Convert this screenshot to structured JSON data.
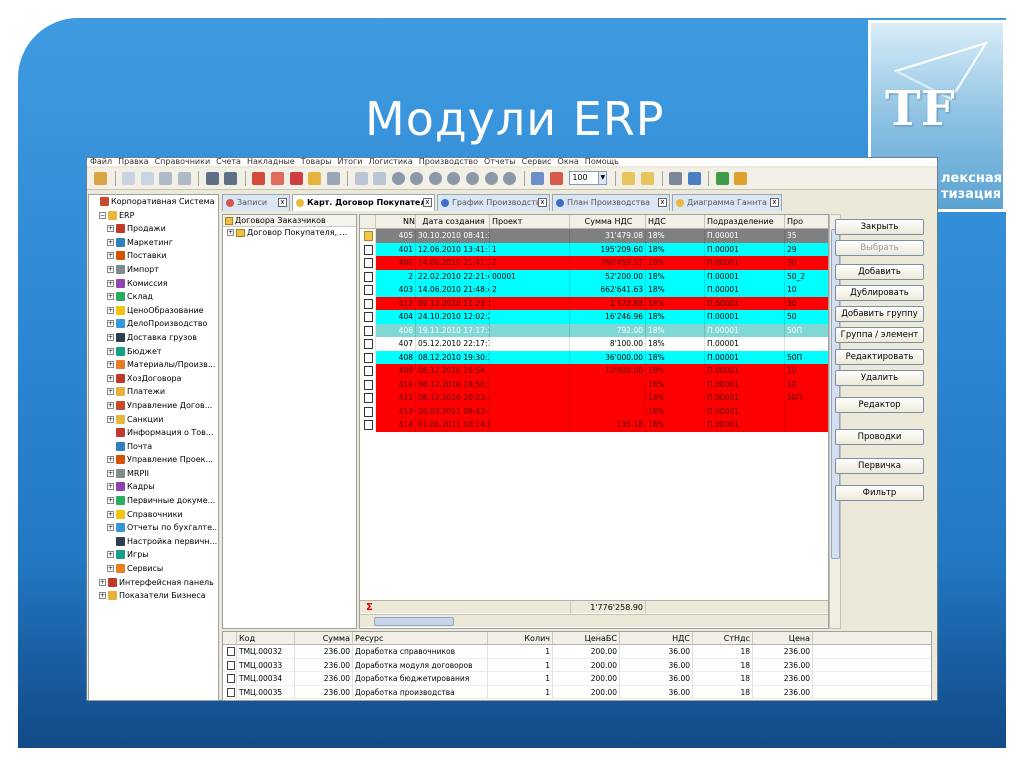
{
  "slide": {
    "title": "Модули ERP"
  },
  "logo": {
    "mark": "TF",
    "text_line1": "лексная",
    "text_line2": "тизация"
  },
  "menu": [
    "Файл",
    "Правка",
    "Справочники",
    "Счета",
    "Накладные",
    "Товары",
    "Итоги",
    "Логистика",
    "Производство",
    "Отчеты",
    "Сервис",
    "Окна",
    "Помощь"
  ],
  "toolbar": {
    "zoom_value": "100",
    "zoom_dropdown": "▼"
  },
  "nav_tree": [
    {
      "label": "Корпоративная Система",
      "level": 0,
      "toggle": ""
    },
    {
      "label": "ERP",
      "level": 1,
      "toggle": "−"
    },
    {
      "label": "Продажи",
      "level": 2,
      "toggle": "+"
    },
    {
      "label": "Маркетинг",
      "level": 2,
      "toggle": "+"
    },
    {
      "label": "Поставки",
      "level": 2,
      "toggle": "+"
    },
    {
      "label": "Импорт",
      "level": 2,
      "toggle": "+"
    },
    {
      "label": "Комиссия",
      "level": 2,
      "toggle": "+"
    },
    {
      "label": "Склад",
      "level": 2,
      "toggle": "+"
    },
    {
      "label": "ЦеноОбразование",
      "level": 2,
      "toggle": "+"
    },
    {
      "label": "ДелоПроизводство",
      "level": 2,
      "toggle": "+"
    },
    {
      "label": "Доставка грузов",
      "level": 2,
      "toggle": "+"
    },
    {
      "label": "Бюджет",
      "level": 2,
      "toggle": "+"
    },
    {
      "label": "Материалы/Произв...",
      "level": 2,
      "toggle": "+"
    },
    {
      "label": "ХозДоговора",
      "level": 2,
      "toggle": "+"
    },
    {
      "label": "Платежи",
      "level": 2,
      "toggle": "+"
    },
    {
      "label": "Управление Догов...",
      "level": 2,
      "toggle": "+"
    },
    {
      "label": "Санкции",
      "level": 2,
      "toggle": "+"
    },
    {
      "label": "Информация о Тов...",
      "level": 2,
      "toggle": ""
    },
    {
      "label": "Почта",
      "level": 2,
      "toggle": ""
    },
    {
      "label": "Управление Проек...",
      "level": 2,
      "toggle": "+"
    },
    {
      "label": "MRPII",
      "level": 2,
      "toggle": "+"
    },
    {
      "label": "Кадры",
      "level": 2,
      "toggle": "+"
    },
    {
      "label": "Первичные докуме...",
      "level": 2,
      "toggle": "+"
    },
    {
      "label": "Справочники",
      "level": 2,
      "toggle": "+"
    },
    {
      "label": "Отчеты по бухгалте...",
      "level": 2,
      "toggle": "+"
    },
    {
      "label": "Настройка первичн...",
      "level": 2,
      "toggle": ""
    },
    {
      "label": "Игры",
      "level": 2,
      "toggle": "+"
    },
    {
      "label": "Сервисы",
      "level": 2,
      "toggle": "+"
    },
    {
      "label": "Интерфейсная панель",
      "level": 1,
      "toggle": "+"
    },
    {
      "label": "Показатели Бизнеса",
      "level": 1,
      "toggle": "+"
    }
  ],
  "tabs": [
    {
      "label": "Записи",
      "close": "x",
      "icon_color": "#d9534f"
    },
    {
      "label": "Карт. Договор Покупателя",
      "close": "x",
      "icon_color": "#e8b93a"
    },
    {
      "label": "График Производства",
      "close": "x",
      "icon_color": "#3a6fc4"
    },
    {
      "label": "План Производства",
      "close": "x",
      "icon_color": "#3a6fc4"
    },
    {
      "label": "Диаграмма Ганнта",
      "close": "x",
      "icon_color": "#e8b93a"
    }
  ],
  "contract_tree": {
    "header": "Договора Заказчиков",
    "items": [
      {
        "label": "Договор Покупателя, ...",
        "toggle": "+"
      }
    ]
  },
  "grid": {
    "columns": [
      "",
      "NN",
      "Дата создания",
      "Проект",
      "Сумма НДС",
      "НДС",
      "Подразделение",
      "Про"
    ],
    "rows": [
      {
        "nn": "405",
        "date": "30.10.2010 08:41:39",
        "project": "",
        "sum": "31'479.08",
        "vat": "18%",
        "dept": "П.00001",
        "pro": "35",
        "bg": "#808080",
        "fg": "#ffffff",
        "icon": "folder"
      },
      {
        "nn": "401",
        "date": "12.06.2010 13:41:14",
        "project": "1",
        "sum": "195'209.60",
        "vat": "18%",
        "dept": "П.00001",
        "pro": "29",
        "bg": "#00ffff",
        "fg": "#000000",
        "icon": "doc"
      },
      {
        "nn": "402",
        "date": "14.06.2010 21:41:24",
        "project": "2",
        "sum": "760'459.57",
        "vat": "18%",
        "dept": "П.00001",
        "pro": "30",
        "bg": "#ff0000",
        "fg": "#5a0000",
        "icon": "doc"
      },
      {
        "nn": "2",
        "date": "22.02.2010 22:21:46",
        "project": "00001",
        "sum": "52'200.00",
        "vat": "18%",
        "dept": "П.00001",
        "pro": "50_2",
        "bg": "#00ffff",
        "fg": "#000000",
        "icon": "doc"
      },
      {
        "nn": "403",
        "date": "14.06.2010 21:48:47",
        "project": "2",
        "sum": "662'641.63",
        "vat": "18%",
        "dept": "П.00001",
        "pro": "10",
        "bg": "#00ffff",
        "fg": "#000000",
        "icon": "doc"
      },
      {
        "nn": "412",
        "date": "09.12.2010 11:23:19",
        "project": "",
        "sum": "1'372.88",
        "vat": "18%",
        "dept": "П.00001",
        "pro": "30",
        "bg": "#ff0000",
        "fg": "#5a0000",
        "icon": "doc"
      },
      {
        "nn": "404",
        "date": "24.10.2010 12:02:23",
        "project": "",
        "sum": "16'246.96",
        "vat": "18%",
        "dept": "П.00001",
        "pro": "50",
        "bg": "#00ffff",
        "fg": "#000000",
        "icon": "doc"
      },
      {
        "nn": "406",
        "date": "19.11.2010 17:17:35",
        "project": "",
        "sum": "792.00",
        "vat": "18%",
        "dept": "П.00001",
        "pro": "50П",
        "bg": "#7fd8d4",
        "fg": "#ffffff",
        "icon": "doc"
      },
      {
        "nn": "407",
        "date": "05.12.2010 22:17:12",
        "project": "",
        "sum": "8'100.00",
        "vat": "18%",
        "dept": "П.00001",
        "pro": "",
        "bg": "#ffffff",
        "fg": "#000000",
        "icon": "doc"
      },
      {
        "nn": "408",
        "date": "08.12.2010 19:30:33",
        "project": "",
        "sum": "36'000.00",
        "vat": "18%",
        "dept": "П.00001",
        "pro": "50П",
        "bg": "#00ffff",
        "fg": "#000000",
        "icon": "doc"
      },
      {
        "nn": "409",
        "date": "08.12.2010 19:54",
        "project": "",
        "sum": "10'800.00",
        "vat": "18%",
        "dept": "П.00001",
        "pro": "10",
        "bg": "#ff0000",
        "fg": "#5a0000",
        "icon": "doc"
      },
      {
        "nn": "410",
        "date": "08.12.2010 19:56:29",
        "project": "",
        "sum": "",
        "vat": "18%",
        "dept": "П.00001",
        "pro": "10",
        "bg": "#ff0000",
        "fg": "#5a0000",
        "icon": "doc"
      },
      {
        "nn": "411",
        "date": "08.12.2010 20:23:48",
        "project": "",
        "sum": "",
        "vat": "18%",
        "dept": "П.00001",
        "pro": "50П",
        "bg": "#ff0000",
        "fg": "#5a0000",
        "icon": "doc"
      },
      {
        "nn": "413",
        "date": "26.03.2011 09:43:37",
        "project": "",
        "sum": "",
        "vat": "18%",
        "dept": "П.00001",
        "pro": "",
        "bg": "#ff0000",
        "fg": "#5a0000",
        "icon": "doc"
      },
      {
        "nn": "414",
        "date": "01.06.2011 18:14:02",
        "project": "",
        "sum": "135.18",
        "vat": "18%",
        "dept": "П.00001",
        "pro": "",
        "bg": "#ff0000",
        "fg": "#5a0000",
        "icon": "doc"
      }
    ],
    "total_sum": "1'776'258.90",
    "sigma": "Σ"
  },
  "buttons": [
    {
      "label": "Закрыть",
      "enabled": true
    },
    {
      "label": "Выбрать",
      "enabled": false
    },
    {
      "label": "Добавить",
      "enabled": true
    },
    {
      "label": "Дублировать",
      "enabled": true
    },
    {
      "label": "Добавить группу",
      "enabled": true
    },
    {
      "label": "Группа / элемент",
      "enabled": true
    },
    {
      "label": "Редактировать",
      "enabled": true
    },
    {
      "label": "Удалить",
      "enabled": true
    },
    {
      "label": "Редактор",
      "enabled": true
    },
    {
      "label": "Проводки",
      "enabled": true
    },
    {
      "label": "Первичка",
      "enabled": true
    },
    {
      "label": "Фильтр",
      "enabled": true
    }
  ],
  "detail": {
    "columns": [
      "",
      "Код",
      "Сумма",
      "Ресурс",
      "Колич",
      "ЦенаБС",
      "НДС",
      "СтНдс",
      "Цена"
    ],
    "rows": [
      {
        "code": "ТМЦ.00032",
        "sum": "236.00",
        "resource": "Доработка справочников",
        "qty": "1",
        "price_bs": "200.00",
        "vat": "36.00",
        "vat_rate": "18",
        "price": "236.00"
      },
      {
        "code": "ТМЦ.00033",
        "sum": "236.00",
        "resource": "Доработка модуля договоров",
        "qty": "1",
        "price_bs": "200.00",
        "vat": "36.00",
        "vat_rate": "18",
        "price": "236.00"
      },
      {
        "code": "ТМЦ.00034",
        "sum": "236.00",
        "resource": "Доработка бюджетирования",
        "qty": "1",
        "price_bs": "200.00",
        "vat": "36.00",
        "vat_rate": "18",
        "price": "236.00"
      },
      {
        "code": "ТМЦ.00035",
        "sum": "236.00",
        "resource": "Доработка производства",
        "qty": "1",
        "price_bs": "200.00",
        "vat": "36.00",
        "vat_rate": "18",
        "price": "236.00"
      }
    ]
  }
}
